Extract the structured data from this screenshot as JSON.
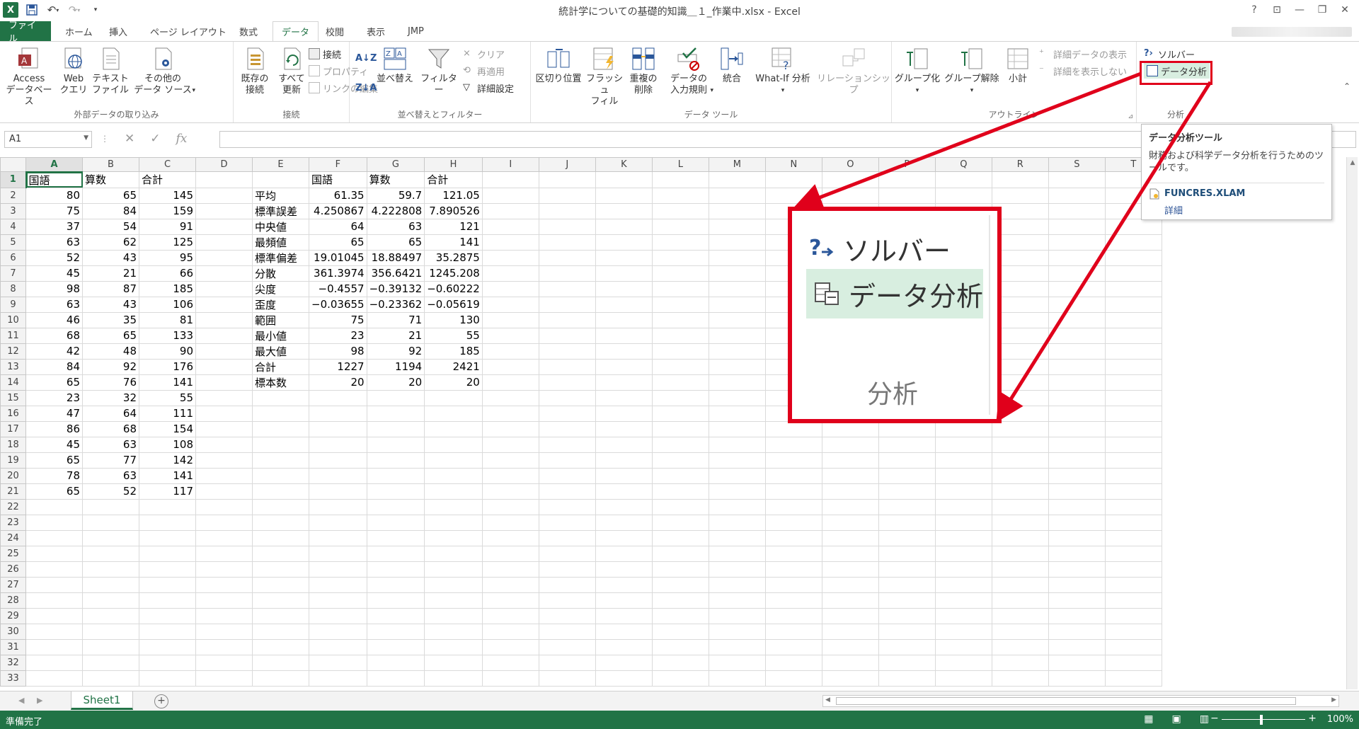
{
  "window": {
    "title": "統計学についての基礎的知識＿１_作業中.xlsx - Excel",
    "app_icon": "X"
  },
  "tabs": [
    "ファイル",
    "ホーム",
    "挿入",
    "ページ レイアウト",
    "数式",
    "データ",
    "校閲",
    "表示",
    "JMP"
  ],
  "active_tab": "データ",
  "ribbon": {
    "external": {
      "label": "外部データの取り込み",
      "access": [
        "Access",
        "データベース"
      ],
      "web": [
        "Web",
        "クエリ"
      ],
      "text": [
        "テキスト",
        "ファイル"
      ],
      "other": [
        "その他の",
        "データ ソース"
      ]
    },
    "connect": {
      "label": "接続",
      "existing": [
        "既存の",
        "接続"
      ],
      "refresh": [
        "すべて",
        "更新"
      ],
      "connections": "接続",
      "properties": "プロパティ",
      "edit_links": "リンクの編集"
    },
    "sort": {
      "label": "並べ替えとフィルター",
      "sort": "並べ替え",
      "filter": "フィルター",
      "clear": "クリア",
      "reapply": "再適用",
      "advanced": "詳細設定"
    },
    "tools": {
      "label": "データ ツール",
      "text_to_columns": "区切り位置",
      "flash_fill": [
        "フラッシュ",
        "フィル"
      ],
      "remove_dup": [
        "重複の",
        "削除"
      ],
      "validation": [
        "データの",
        "入力規則"
      ],
      "consolidate": "統合",
      "whatif": "What-If 分析",
      "relationships": "リレーションシップ"
    },
    "outline": {
      "label": "アウトライン",
      "group": "グループ化",
      "ungroup": "グループ解除",
      "subtotal": "小計",
      "show_detail": "詳細データの表示",
      "hide_detail": "詳細を表示しない"
    },
    "analysis": {
      "label": "分析",
      "solver": "ソルバー",
      "data_analysis": "データ分析"
    }
  },
  "formula_bar": {
    "name_box": "A1",
    "fx": "fx",
    "value": ""
  },
  "grid": {
    "columns": [
      "A",
      "B",
      "C",
      "D",
      "E",
      "F",
      "G",
      "H",
      "I",
      "J",
      "K",
      "L",
      "M",
      "N",
      "O",
      "P",
      "Q",
      "R",
      "S",
      "T"
    ],
    "row_count": 33,
    "rows": [
      [
        "国語",
        "算数",
        "合計",
        "",
        "",
        "国語",
        "算数",
        "合計"
      ],
      [
        "80",
        "65",
        "145",
        "",
        "平均",
        "61.35",
        "59.7",
        "121.05"
      ],
      [
        "75",
        "84",
        "159",
        "",
        "標準誤差",
        "4.250867",
        "4.222808",
        "7.890526"
      ],
      [
        "37",
        "54",
        "91",
        "",
        "中央値",
        "64",
        "63",
        "121"
      ],
      [
        "63",
        "62",
        "125",
        "",
        "最頻値",
        "65",
        "65",
        "141"
      ],
      [
        "52",
        "43",
        "95",
        "",
        "標準偏差",
        "19.01045",
        "18.88497",
        "35.2875"
      ],
      [
        "45",
        "21",
        "66",
        "",
        "分散",
        "361.3974",
        "356.6421",
        "1245.208"
      ],
      [
        "98",
        "87",
        "185",
        "",
        "尖度",
        "−0.4557",
        "−0.39132",
        "−0.60222"
      ],
      [
        "63",
        "43",
        "106",
        "",
        "歪度",
        "−0.03655",
        "−0.23362",
        "−0.05619"
      ],
      [
        "46",
        "35",
        "81",
        "",
        "範囲",
        "75",
        "71",
        "130"
      ],
      [
        "68",
        "65",
        "133",
        "",
        "最小値",
        "23",
        "21",
        "55"
      ],
      [
        "42",
        "48",
        "90",
        "",
        "最大値",
        "98",
        "92",
        "185"
      ],
      [
        "84",
        "92",
        "176",
        "",
        "合計",
        "1227",
        "1194",
        "2421"
      ],
      [
        "65",
        "76",
        "141",
        "",
        "標本数",
        "20",
        "20",
        "20"
      ],
      [
        "23",
        "32",
        "55"
      ],
      [
        "47",
        "64",
        "111"
      ],
      [
        "86",
        "68",
        "154"
      ],
      [
        "45",
        "63",
        "108"
      ],
      [
        "65",
        "77",
        "142"
      ],
      [
        "78",
        "63",
        "141"
      ],
      [
        "65",
        "52",
        "117"
      ]
    ]
  },
  "sheet_tabs": [
    "Sheet1"
  ],
  "status": {
    "ready": "準備完了",
    "zoom": "100%"
  },
  "tooltip": {
    "title": "データ分析ツール",
    "description": "財務および科学データ分析を行うためのツールです。",
    "addin": "FUNCRES.XLAM",
    "more": "詳細"
  },
  "callout": {
    "solver": "ソルバー",
    "data_analysis": "データ分析",
    "group": "分析"
  },
  "colors": {
    "excel_green": "#217346",
    "highlight_red": "#e0001b",
    "hover_green": "#d8eee0"
  }
}
